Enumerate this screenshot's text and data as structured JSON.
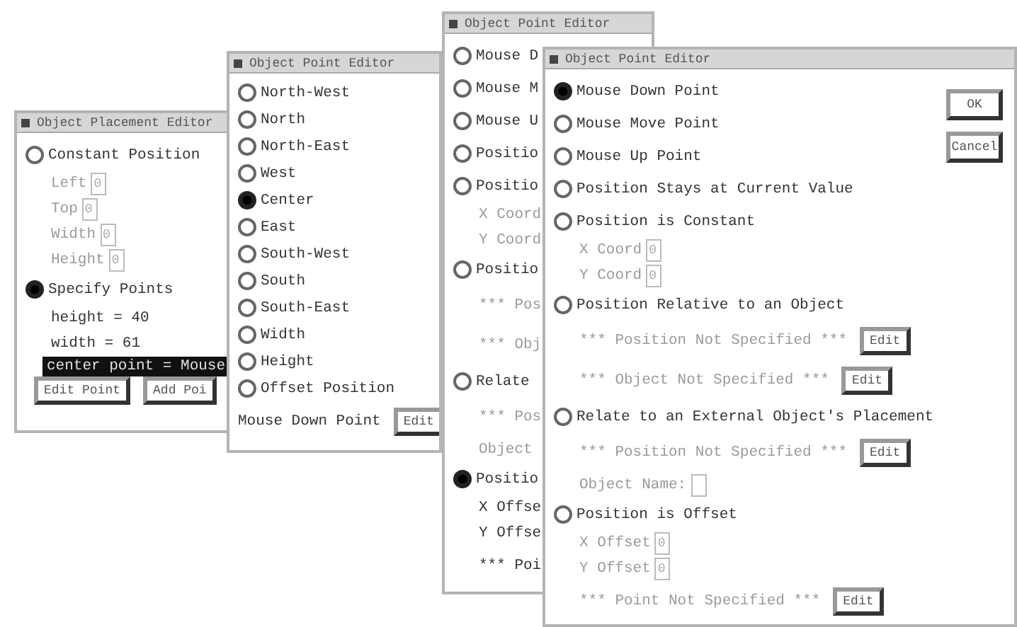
{
  "windows": [
    {
      "title": "Object Placement Editor",
      "items": [
        {
          "kind": "radio",
          "label": "Constant Position",
          "selected": false
        },
        {
          "kind": "field",
          "label": "Left",
          "value": "0",
          "disabled": true
        },
        {
          "kind": "field",
          "label": "Top",
          "value": "0",
          "disabled": true
        },
        {
          "kind": "field",
          "label": "Width",
          "value": "0",
          "disabled": true
        },
        {
          "kind": "field",
          "label": "Height",
          "value": "0",
          "disabled": true
        },
        {
          "kind": "radio",
          "label": "Specify Points",
          "selected": true
        },
        {
          "kind": "text",
          "label": "height = 40"
        },
        {
          "kind": "text",
          "label": "width = 61"
        },
        {
          "kind": "highlight",
          "label": "center point = Mouse"
        },
        {
          "kind": "buttons",
          "buttons": [
            "Edit Point",
            "Add Poi"
          ]
        }
      ]
    },
    {
      "title": "Object Point Editor",
      "items": [
        {
          "kind": "radio",
          "label": "North-West",
          "selected": false
        },
        {
          "kind": "radio",
          "label": "North",
          "selected": false
        },
        {
          "kind": "radio",
          "label": "North-East",
          "selected": false
        },
        {
          "kind": "radio",
          "label": "West",
          "selected": false
        },
        {
          "kind": "radio",
          "label": "Center",
          "selected": true
        },
        {
          "kind": "radio",
          "label": "East",
          "selected": false
        },
        {
          "kind": "radio",
          "label": "South-West",
          "selected": false
        },
        {
          "kind": "radio",
          "label": "South",
          "selected": false
        },
        {
          "kind": "radio",
          "label": "South-East",
          "selected": false
        },
        {
          "kind": "radio",
          "label": "Width",
          "selected": false
        },
        {
          "kind": "radio",
          "label": "Height",
          "selected": false
        },
        {
          "kind": "radio",
          "label": "Offset Position",
          "selected": false
        },
        {
          "kind": "caption",
          "label": "Mouse Down Point",
          "button": "Edit"
        }
      ]
    },
    {
      "title": "Object Point Editor",
      "items": [
        {
          "kind": "radio",
          "label": "Mouse D",
          "selected": false
        },
        {
          "kind": "radio",
          "label": "Mouse M",
          "selected": false
        },
        {
          "kind": "radio",
          "label": "Mouse U",
          "selected": false
        },
        {
          "kind": "radio",
          "label": "Positio",
          "selected": false
        },
        {
          "kind": "radio",
          "label": "Positio",
          "selected": false
        },
        {
          "kind": "field",
          "label": "X Coord",
          "disabled": true
        },
        {
          "kind": "field",
          "label": "Y Coord",
          "disabled": true
        },
        {
          "kind": "radio",
          "label": "Positio",
          "selected": false
        },
        {
          "kind": "note",
          "label": "*** Pos",
          "disabled": true
        },
        {
          "kind": "note",
          "label": "*** Obj",
          "disabled": true
        },
        {
          "kind": "radio",
          "label": "Relate",
          "selected": false
        },
        {
          "kind": "note",
          "label": "*** Pos",
          "disabled": true
        },
        {
          "kind": "field",
          "label": "Object",
          "disabled": true
        },
        {
          "kind": "radio",
          "label": "Positio",
          "selected": true
        },
        {
          "kind": "field",
          "label": "X Offse",
          "disabled": false
        },
        {
          "kind": "field",
          "label": "Y Offse",
          "disabled": false
        },
        {
          "kind": "note",
          "label": "*** Poi",
          "disabled": false
        }
      ]
    },
    {
      "title": "Object Point Editor",
      "side_buttons": [
        "OK",
        "Cancel"
      ],
      "items": [
        {
          "kind": "radio",
          "label": "Mouse Down Point",
          "selected": true
        },
        {
          "kind": "radio",
          "label": "Mouse Move Point",
          "selected": false
        },
        {
          "kind": "radio",
          "label": "Mouse Up Point",
          "selected": false
        },
        {
          "kind": "radio",
          "label": "Position Stays at Current Value",
          "selected": false
        },
        {
          "kind": "radio",
          "label": "Position is Constant",
          "selected": false
        },
        {
          "kind": "field",
          "label": "X Coord",
          "value": "0",
          "disabled": true
        },
        {
          "kind": "field",
          "label": "Y Coord",
          "value": "0",
          "disabled": true
        },
        {
          "kind": "radio",
          "label": "Position Relative to an Object",
          "selected": false
        },
        {
          "kind": "note",
          "label": "*** Position Not Specified ***",
          "button": "Edit",
          "disabled": true
        },
        {
          "kind": "note",
          "label": "*** Object Not Specified ***",
          "button": "Edit",
          "disabled": true
        },
        {
          "kind": "radio",
          "label": "Relate to an External Object's Placement",
          "selected": false
        },
        {
          "kind": "note",
          "label": "*** Position Not Specified ***",
          "button": "Edit",
          "disabled": true
        },
        {
          "kind": "field",
          "label": "Object Name:",
          "value": "",
          "disabled": true
        },
        {
          "kind": "radio",
          "label": "Position is Offset",
          "selected": false
        },
        {
          "kind": "field",
          "label": "X Offset",
          "value": "0",
          "disabled": true
        },
        {
          "kind": "field",
          "label": "Y Offset",
          "value": "0",
          "disabled": true
        },
        {
          "kind": "note",
          "label": "*** Point Not Specified ***",
          "button": "Edit",
          "disabled": true
        }
      ]
    }
  ]
}
